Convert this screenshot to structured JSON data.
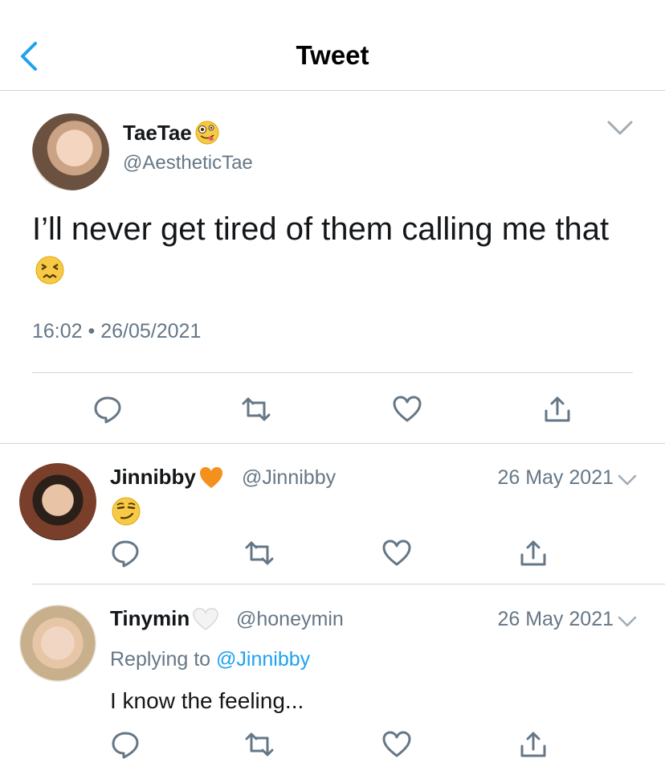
{
  "nav": {
    "title": "Tweet"
  },
  "tweet": {
    "name": "TaeTae",
    "handle": "@AestheticTae",
    "text": "I’ll never get tired of them calling me that",
    "time": "16:02",
    "separator": "•",
    "date": "26/05/2021",
    "name_emoji": "zany-face-emoji",
    "text_emoji": "persevering-face-emoji"
  },
  "replies": [
    {
      "name": "Jinnibby",
      "name_emoji": "orange-heart-emoji",
      "handle": "@Jinnibby",
      "date": "26 May 2021",
      "body_emoji": "smirking-face-emoji"
    },
    {
      "name": "Tinymin",
      "name_emoji": "white-heart-emoji",
      "handle": "@honeymin",
      "date": "26 May 2021",
      "replying_prefix": "Replying to",
      "replying_to": "@Jinnibby",
      "text": "I know the feeling..."
    }
  ],
  "colors": {
    "accent": "#1da1f2",
    "secondary_text": "#657786",
    "divider": "#cfd4d8",
    "icon": "#657786"
  }
}
